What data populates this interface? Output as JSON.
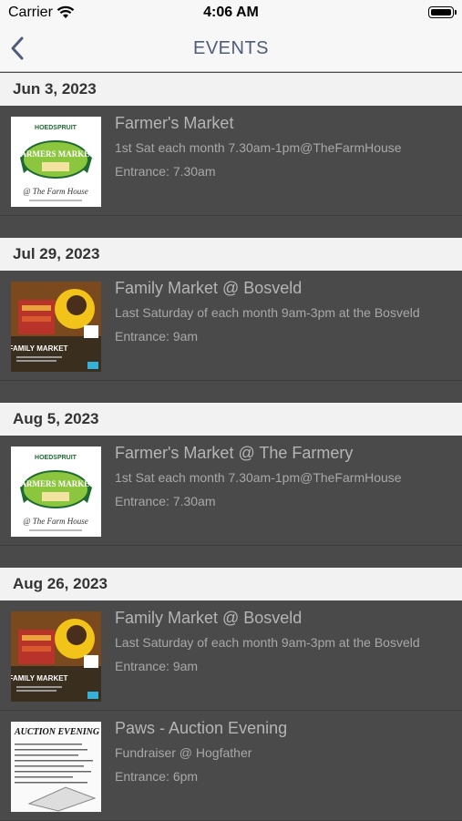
{
  "status_bar": {
    "carrier": "Carrier",
    "time": "4:06 AM"
  },
  "nav": {
    "title": "EVENTS"
  },
  "sections": [
    {
      "date": "Jun 3, 2023",
      "events": [
        {
          "title": "Farmer's Market",
          "description": "1st Sat each month 7.30am-1pm@TheFarmHouse",
          "entrance": "Entrance: 7.30am",
          "thumb": "farmers-market"
        }
      ]
    },
    {
      "date": "Jul 29, 2023",
      "events": [
        {
          "title": "Family Market @ Bosveld",
          "description": "Last Saturday of each month 9am-3pm at the Bosveld",
          "entrance": "Entrance: 9am",
          "thumb": "family-market"
        }
      ]
    },
    {
      "date": "Aug 5, 2023",
      "events": [
        {
          "title": "Farmer's Market @ The Farmery",
          "description": "1st Sat each month 7.30am-1pm@TheFarmHouse",
          "entrance": "Entrance: 7.30am",
          "thumb": "farmers-market"
        }
      ]
    },
    {
      "date": "Aug 26, 2023",
      "events": [
        {
          "title": "Family Market @ Bosveld",
          "description": "Last Saturday of each month 9am-3pm at the Bosveld",
          "entrance": "Entrance: 9am",
          "thumb": "family-market"
        },
        {
          "title": "Paws - Auction Evening",
          "description": "Fundraiser @ Hogfather",
          "entrance": "Entrance: 6pm",
          "thumb": "auction-evening"
        }
      ]
    }
  ],
  "thumb_text": {
    "farmers_market": {
      "top": "HOEDSPRUIT",
      "main": "FARMERS MARKET",
      "script": "@ The Farm House"
    },
    "family_market": {
      "main": "FAMILY MARKET"
    },
    "auction": {
      "main": "AUCTION EVENING"
    }
  }
}
